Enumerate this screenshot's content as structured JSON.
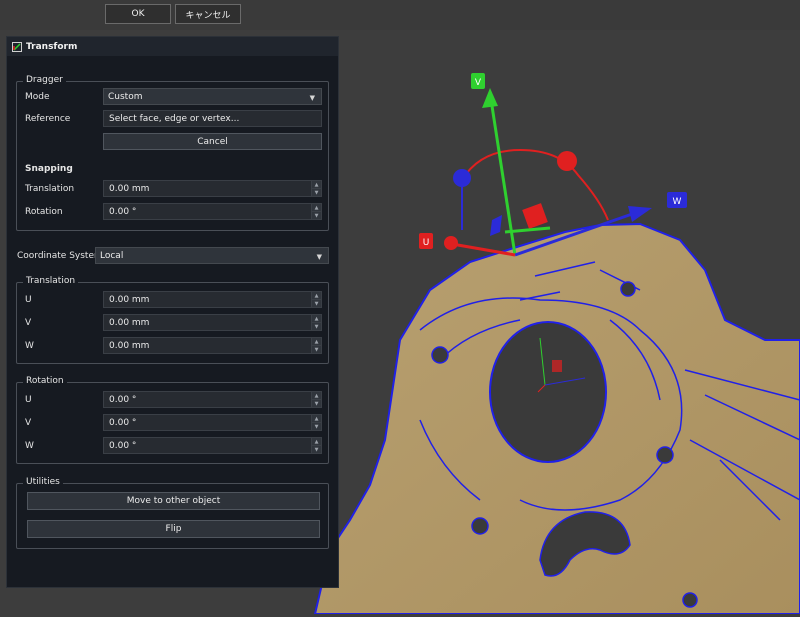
{
  "dialog_buttons": {
    "ok": "OK",
    "cancel": "キャンセル"
  },
  "panel": {
    "title": "Transform"
  },
  "dragger": {
    "legend": "Dragger",
    "mode_label": "Mode",
    "mode_value": "Custom",
    "reference_label": "Reference",
    "reference_value": "Select face, edge or vertex...",
    "cancel_button": "Cancel",
    "snapping_label": "Snapping",
    "translation_label": "Translation",
    "translation_value": "0.00 mm",
    "rotation_label": "Rotation",
    "rotation_value": "0.00 °"
  },
  "coordinate_system": {
    "label": "Coordinate System",
    "value": "Local"
  },
  "translation": {
    "legend": "Translation",
    "u_label": "U",
    "u_value": "0.00 mm",
    "v_label": "V",
    "v_value": "0.00 mm",
    "w_label": "W",
    "w_value": "0.00 mm"
  },
  "rotation": {
    "legend": "Rotation",
    "u_label": "U",
    "u_value": "0.00 °",
    "v_label": "V",
    "v_value": "0.00 °",
    "w_label": "W",
    "w_value": "0.00 °"
  },
  "utilities": {
    "legend": "Utilities",
    "move_button": "Move to other object",
    "flip_button": "Flip"
  },
  "gizmo": {
    "v_label": "V",
    "w_label": "W",
    "u_label": "U",
    "colors": {
      "v": "#2fd02f",
      "w": "#2b2bd8",
      "u": "#e02020",
      "part": "#b59a68",
      "edge": "#2020e8"
    }
  }
}
